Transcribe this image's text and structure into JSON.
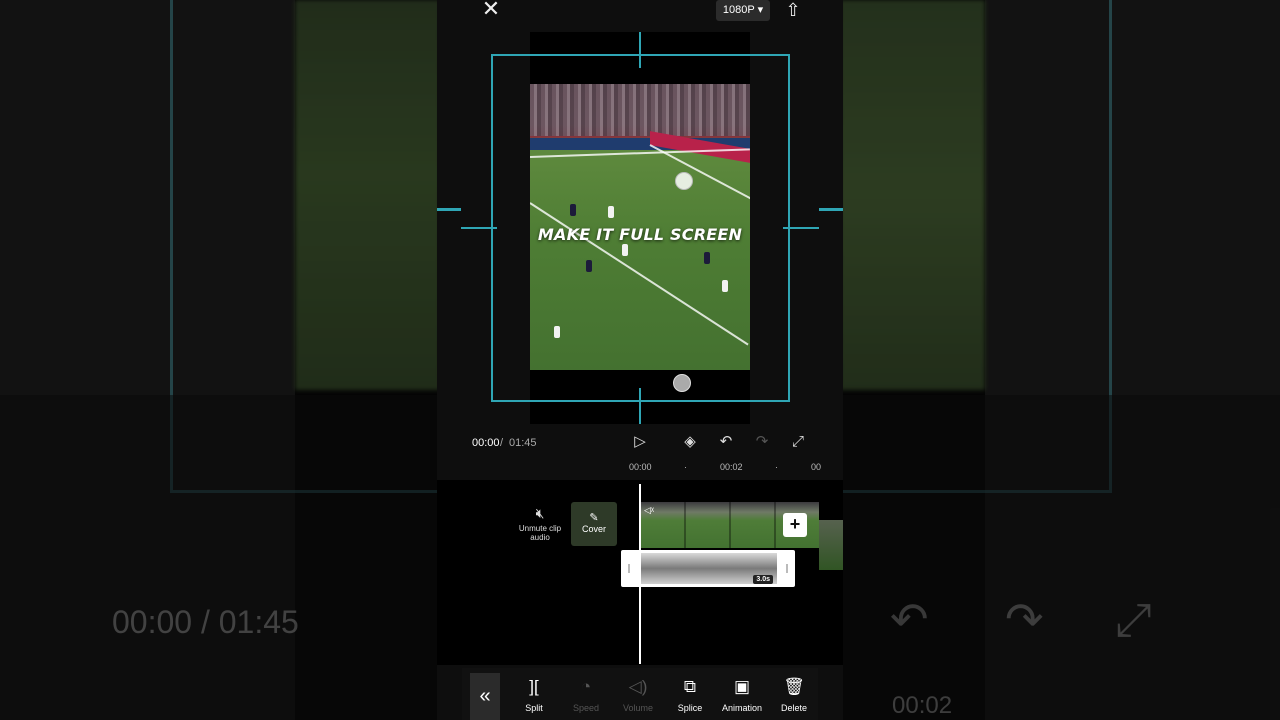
{
  "top_bar": {
    "close_icon": "close-icon",
    "resolution": "1080P",
    "resolution_caret": "▾",
    "export_icon": "export-icon"
  },
  "preview": {
    "overlay_text": "MAKE IT FULL SCREEN"
  },
  "playback": {
    "current_time": "00:00",
    "separator": "/",
    "total_time": "01:45",
    "icons": [
      "play-icon",
      "keyframe-icon",
      "undo-icon",
      "redo-icon",
      "fullscreen-icon"
    ]
  },
  "timeline": {
    "ruler": [
      "00:00",
      "00:02",
      "00"
    ],
    "unmute_label": "Unmute clip audio",
    "cover_label": "Cover",
    "text_duration": "3.0s"
  },
  "toolbar": {
    "items": [
      {
        "label": "Split",
        "enabled": true
      },
      {
        "label": "Speed",
        "enabled": false
      },
      {
        "label": "Volume",
        "enabled": false
      },
      {
        "label": "Splice",
        "enabled": true
      },
      {
        "label": "Animation",
        "enabled": true
      },
      {
        "label": "Delete",
        "enabled": true
      }
    ]
  },
  "background_ghost": {
    "time_display": "00:00 / 01:45",
    "ruler_time": "00:02"
  },
  "colors": {
    "guide": "#2fa6b5",
    "panel": "#0e0e0e",
    "button_bg": "#2b2b2b"
  }
}
